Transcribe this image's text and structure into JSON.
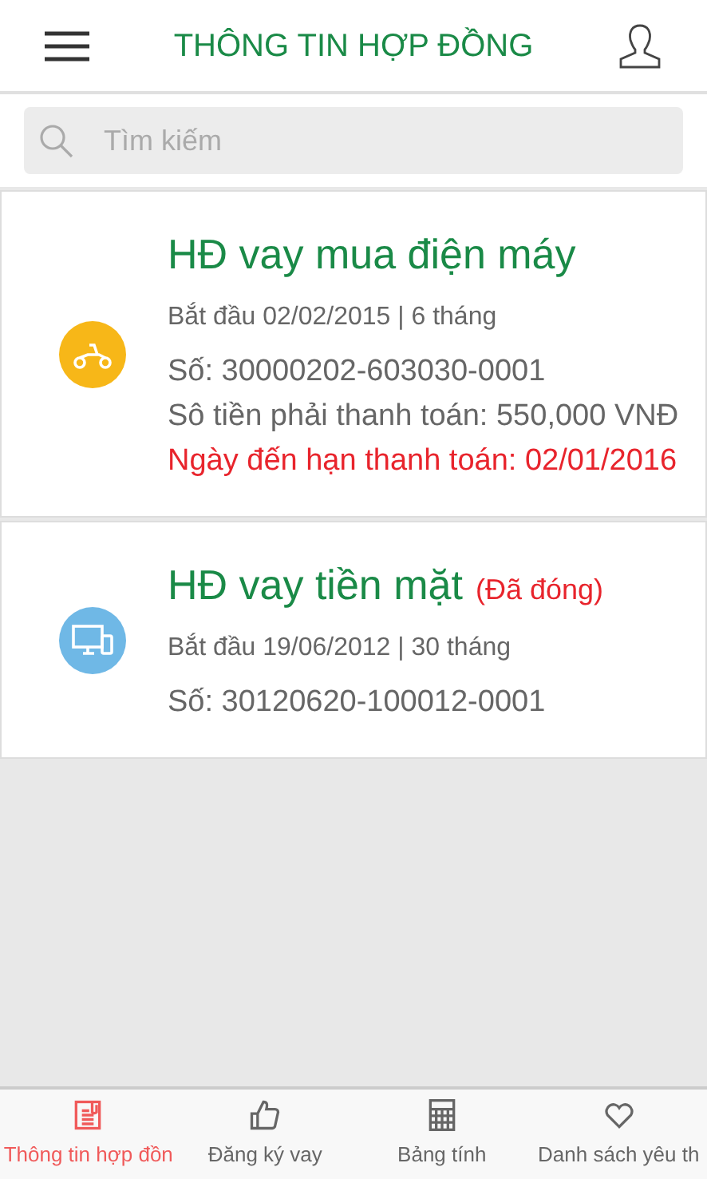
{
  "header": {
    "title": "THÔNG TIN HỢP ĐỒNG"
  },
  "search": {
    "placeholder": "Tìm kiếm"
  },
  "contracts": [
    {
      "kind": "scooter",
      "title": "HĐ vay mua điện máy",
      "start": "Bắt đầu 02/02/2015 | 6 tháng",
      "number": "Số: 30000202-603030-0001",
      "amount": "Sô tiền phải thanh toán: 550,000 VNĐ",
      "due": "Ngày đến hạn thanh toán: 02/01/2016"
    },
    {
      "kind": "monitor",
      "title": "HĐ vay tiền mặt",
      "status": "(Đã đóng)",
      "start": "Bắt đầu 19/06/2012 | 30 tháng",
      "number": "Số: 30120620-100012-0001"
    }
  ],
  "tabs": [
    {
      "kind": "contract",
      "label": "Thông tin hợp đồn",
      "selected": true
    },
    {
      "kind": "thumb",
      "label": "Đăng ký vay",
      "selected": false
    },
    {
      "kind": "calculator",
      "label": "Bảng tính",
      "selected": false
    },
    {
      "kind": "heart",
      "label": "Danh sách yêu th",
      "selected": false
    }
  ]
}
